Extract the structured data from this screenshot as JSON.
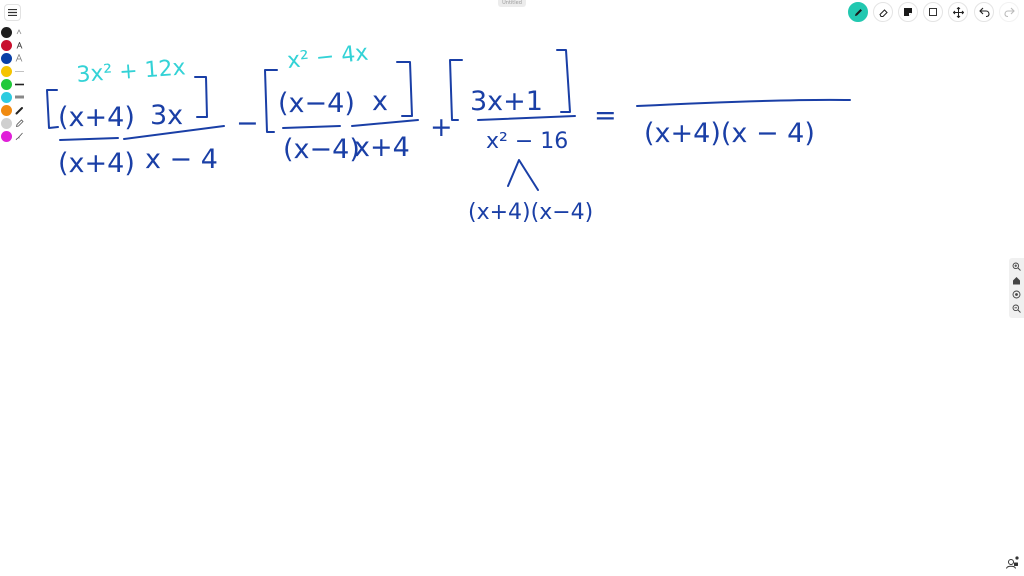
{
  "app": {
    "top_label": "Untitled"
  },
  "colors": {
    "accent": "#22c8b0",
    "ink_blue": "#1a3fa6",
    "ink_cyan": "#33d2d6"
  },
  "palette": {
    "swatches": [
      "#1e1e1e",
      "#c8102e",
      "#0a3fa6",
      "#f5c400",
      "#20c93a",
      "#2ecbe0",
      "#f08a10",
      "#cfcfcf",
      "#e020d8"
    ],
    "tool_icons": [
      "caret-icon",
      "text-icon",
      "text-outline-icon",
      "thin-line-icon",
      "medium-line-icon",
      "thick-line-icon",
      "pen-icon",
      "pencil-icon",
      "brush-icon"
    ]
  },
  "toolbar": {
    "tools": [
      "pen-icon",
      "eraser-icon",
      "sticky-note-icon",
      "select-icon",
      "move-icon",
      "undo-icon",
      "redo-icon"
    ]
  },
  "zoom": {
    "buttons": [
      "zoom-in-icon",
      "home-icon",
      "target-icon",
      "zoom-out-icon"
    ]
  },
  "handwriting": {
    "term1": {
      "bracket_num": "(x+4)",
      "num": "3x",
      "factor_den": "(x+4)",
      "den": "x − 4",
      "annotation": "3x² + 12x"
    },
    "op1": "−",
    "term2": {
      "bracket_num": "(x−4)",
      "num": "x",
      "factor_den": "(x−4)",
      "den": "x+4",
      "annotation": "x² − 4x"
    },
    "op2": "+",
    "term3": {
      "num": "3x+1",
      "den": "x² − 16",
      "factor": "(x+4)(x−4)"
    },
    "equals": "=",
    "result_den": "(x+4)(x − 4)"
  }
}
